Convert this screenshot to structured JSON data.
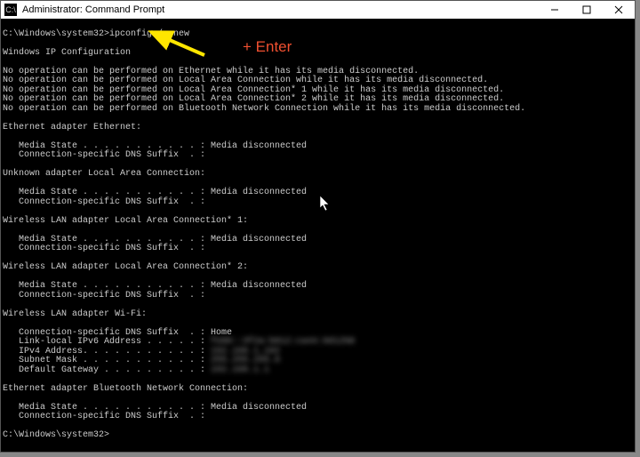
{
  "window": {
    "title": "Administrator: Command Prompt",
    "icon_label": "C:\\"
  },
  "annotation": {
    "enter_text": "+ Enter"
  },
  "terminal": {
    "prompt1_path": "C:\\Windows\\system32>",
    "prompt1_cmd": "ipconfig /renew",
    "heading": "Windows IP Configuration",
    "noop_lines": [
      "No operation can be performed on Ethernet while it has its media disconnected.",
      "No operation can be performed on Local Area Connection while it has its media disconnected.",
      "No operation can be performed on Local Area Connection* 1 while it has its media disconnected.",
      "No operation can be performed on Local Area Connection* 2 while it has its media disconnected.",
      "No operation can be performed on Bluetooth Network Connection while it has its media disconnected."
    ],
    "sections": [
      {
        "title": "Ethernet adapter Ethernet:",
        "lines": [
          "   Media State . . . . . . . . . . . : Media disconnected",
          "   Connection-specific DNS Suffix  . :"
        ]
      },
      {
        "title": "Unknown adapter Local Area Connection:",
        "lines": [
          "   Media State . . . . . . . . . . . : Media disconnected",
          "   Connection-specific DNS Suffix  . :"
        ]
      },
      {
        "title": "Wireless LAN adapter Local Area Connection* 1:",
        "lines": [
          "   Media State . . . . . . . . . . . : Media disconnected",
          "   Connection-specific DNS Suffix  . :"
        ]
      },
      {
        "title": "Wireless LAN adapter Local Area Connection* 2:",
        "lines": [
          "   Media State . . . . . . . . . . . : Media disconnected",
          "   Connection-specific DNS Suffix  . :"
        ]
      },
      {
        "title": "Wireless LAN adapter Wi-Fi:",
        "lines": [
          "   Connection-specific DNS Suffix  . : Home"
        ],
        "blurred": [
          "   Link-local IPv6 Address . . . . . : fe80::3f2a:b812:ca44:9d12%8",
          "   IPv4 Address. . . . . . . . . . . : 192.168.1.102",
          "   Subnet Mask . . . . . . . . . . . : 255.255.255.0",
          "   Default Gateway . . . . . . . . . : 192.168.1.1"
        ]
      },
      {
        "title": "Ethernet adapter Bluetooth Network Connection:",
        "lines": [
          "   Media State . . . . . . . . . . . : Media disconnected",
          "   Connection-specific DNS Suffix  . :"
        ]
      }
    ],
    "prompt2": "C:\\Windows\\system32>"
  }
}
